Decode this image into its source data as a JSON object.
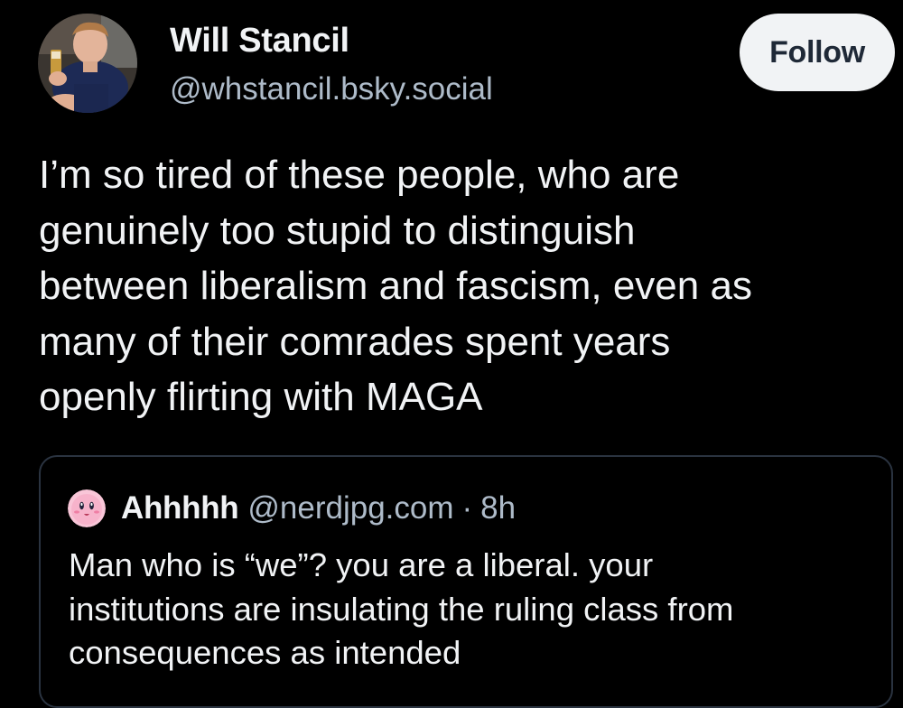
{
  "post": {
    "author": {
      "display_name": "Will Stancil",
      "handle": "@whstancil.bsky.social",
      "avatar_icon": "profile-photo-avatar-icon"
    },
    "follow_label": "Follow",
    "text_lines": [
      "I’m so tired of these people, who are",
      "genuinely too stupid to distinguish",
      "between liberalism and fascism, even as",
      "many of their comrades spent years",
      "openly flirting with MAGA"
    ]
  },
  "quoted_post": {
    "author": {
      "display_name": "Ahhhhh",
      "handle": "@nerdjpg.com",
      "avatar_icon": "kirby-avatar-icon"
    },
    "separator": "·",
    "time": "8h",
    "text_lines": [
      "Man who is “we”? you are a liberal. your",
      "institutions are insulating the ruling class from",
      "consequences as intended"
    ]
  },
  "colors": {
    "background": "#000000",
    "text_primary": "#f1f3f5",
    "text_secondary": "#aebbc9",
    "follow_button_bg": "#f1f3f5",
    "follow_button_text": "#1f2937",
    "quote_border": "#2a3340"
  }
}
